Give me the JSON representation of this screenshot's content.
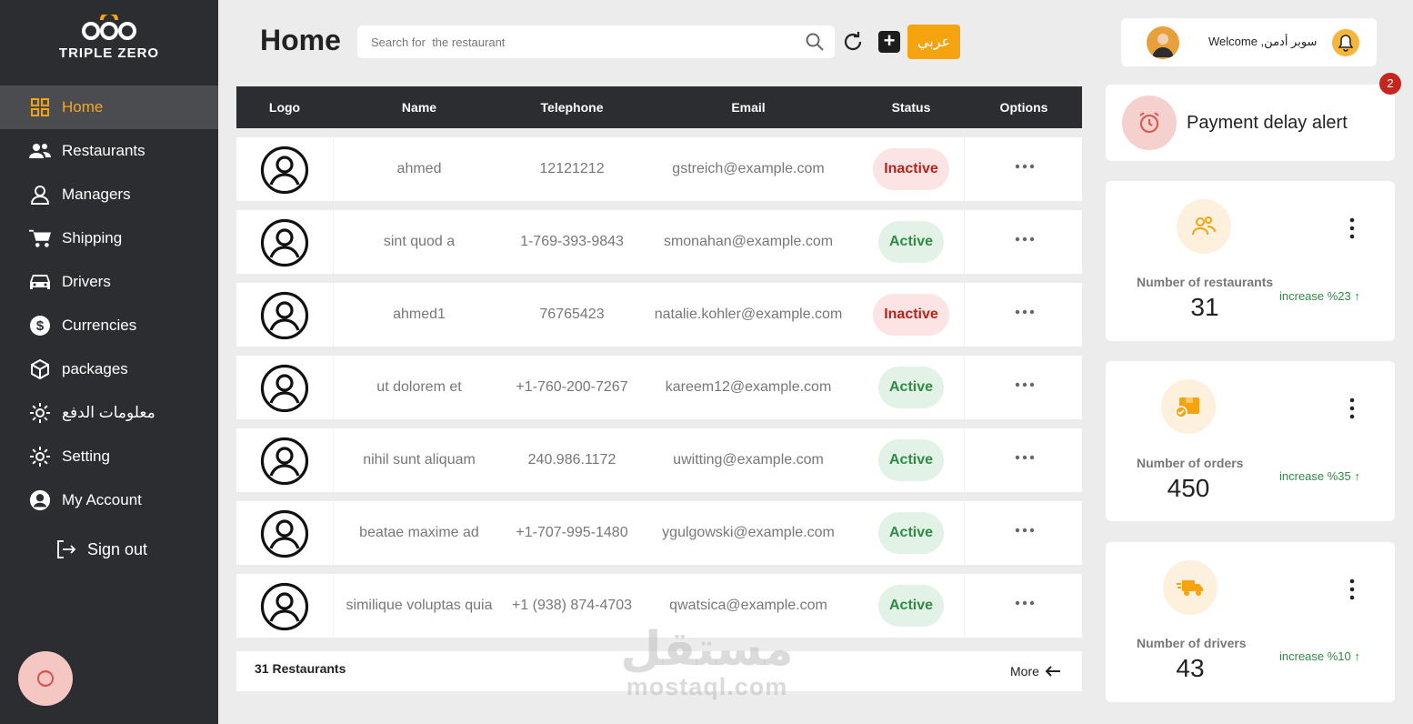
{
  "brand": {
    "name": "TRIPLE ZERO"
  },
  "sidebar": {
    "items": [
      {
        "label": "Home",
        "icon": "grid-icon",
        "active": true
      },
      {
        "label": "Restaurants",
        "icon": "users-icon"
      },
      {
        "label": "Managers",
        "icon": "user-icon"
      },
      {
        "label": "Shipping",
        "icon": "cart-icon"
      },
      {
        "label": "Drivers",
        "icon": "car-icon"
      },
      {
        "label": "Currencies",
        "icon": "dollar-icon"
      },
      {
        "label": "packages",
        "icon": "package-icon"
      },
      {
        "label": "معلومات الدفع",
        "icon": "gear-icon"
      },
      {
        "label": "Setting",
        "icon": "gear-icon"
      },
      {
        "label": "My Account",
        "icon": "account-icon"
      }
    ],
    "signout": "Sign out"
  },
  "header": {
    "title": "Home",
    "search_placeholder": "Search for  the restaurant",
    "lang_button": "عربي",
    "welcome": "Welcome ,سوبر أدمن"
  },
  "table": {
    "columns": [
      "Logo",
      "Name",
      "Telephone",
      "Email",
      "Status",
      "Options"
    ],
    "rows": [
      {
        "name": "ahmed",
        "telephone": "12121212",
        "email": "gstreich@example.com",
        "status": "Inactive"
      },
      {
        "name": "sint quod a",
        "telephone": "1-769-393-9843",
        "email": "smonahan@example.com",
        "status": "Active"
      },
      {
        "name": "ahmed1",
        "telephone": "76765423",
        "email": "natalie.kohler@example.com",
        "status": "Inactive"
      },
      {
        "name": "ut dolorem et",
        "telephone": "+1-760-200-7267",
        "email": "kareem12@example.com",
        "status": "Active"
      },
      {
        "name": "nihil sunt aliquam",
        "telephone": "240.986.1172",
        "email": "uwitting@example.com",
        "status": "Active"
      },
      {
        "name": "beatae maxime ad",
        "telephone": "+1-707-995-1480",
        "email": "ygulgowski@example.com",
        "status": "Active"
      },
      {
        "name": "similique voluptas quia",
        "telephone": "+1 (938) 874-4703",
        "email": "qwatsica@example.com",
        "status": "Active"
      }
    ],
    "footer_count": "31 Restaurants",
    "more_label": "More"
  },
  "alert": {
    "text": "Payment delay alert",
    "badge": "2"
  },
  "stats": [
    {
      "label": "Number of restaurants",
      "value": "31",
      "trend": "increase %23"
    },
    {
      "label": "Number of orders",
      "value": "450",
      "trend": "increase %35"
    },
    {
      "label": "Number of drivers",
      "value": "43",
      "trend": "increase %10"
    }
  ],
  "watermark": {
    "arabic": "مستقل",
    "latin": "mostaql.com"
  },
  "colors": {
    "accent": "#f5a30f",
    "sidebar": "#2b2d30",
    "active_green": "#2f8a45",
    "inactive_red": "#b3241a"
  }
}
